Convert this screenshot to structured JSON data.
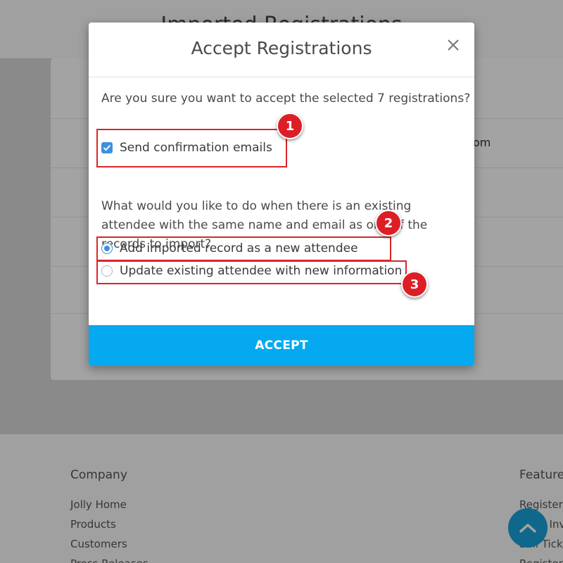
{
  "background": {
    "header_title": "Imported Registrations",
    "row_fragment": "om",
    "footer": {
      "company": {
        "heading": "Company",
        "links": [
          "Jolly Home",
          "Products",
          "Customers",
          "Press Releases"
        ]
      },
      "features": {
        "heading": "Features",
        "links": [
          "Register",
          "Send Invi",
          "Sell Ticke",
          "Register"
        ]
      }
    }
  },
  "modal": {
    "title": "Accept Registrations",
    "close_icon": "close-icon",
    "question": "Are you sure you want to accept the selected 7 registrations?",
    "send_emails": {
      "label": "Send confirmation emails",
      "checked": true
    },
    "duplicate_prompt": "What would you like to do when there is an existing attendee with the same name and email as one of the records to import?",
    "options": [
      {
        "label": "Add imported record as a new attendee",
        "selected": true
      },
      {
        "label": "Update existing attendee with new information",
        "selected": false
      }
    ],
    "accept_label": "ACCEPT"
  },
  "annotations": [
    "1",
    "2",
    "3"
  ],
  "colors": {
    "accent": "#05a9f0",
    "checkbox": "#3d8fe0",
    "callout": "#dc1f26"
  }
}
